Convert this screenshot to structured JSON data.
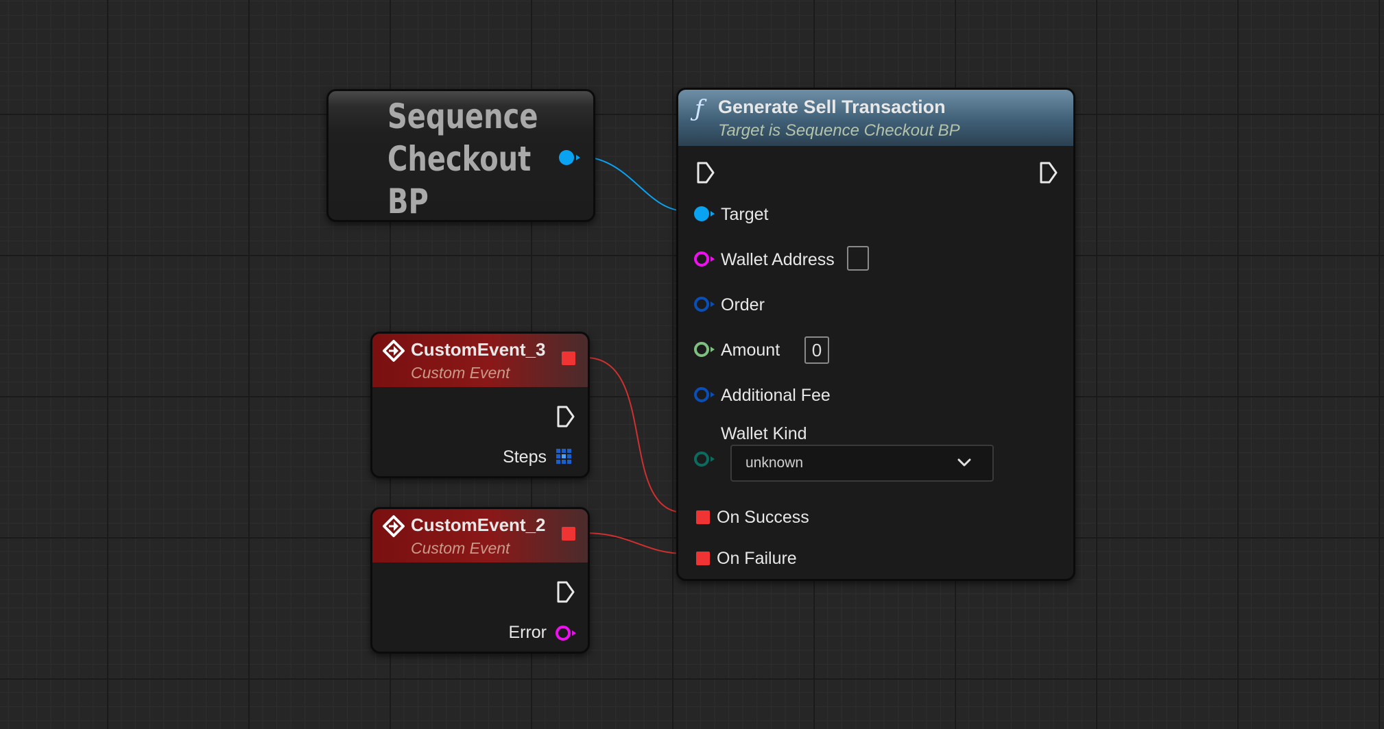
{
  "graph": {
    "variable_node": {
      "title": "Sequence\nCheckout\nBP"
    },
    "function_node": {
      "icon": "function-icon",
      "title": "Generate Sell Transaction",
      "subtitle": "Target is Sequence Checkout BP",
      "pins": {
        "target": "Target",
        "wallet_address": "Wallet Address",
        "order": "Order",
        "amount": "Amount",
        "amount_value": "0",
        "additional_fee": "Additional Fee",
        "wallet_kind": "Wallet Kind",
        "wallet_kind_value": "unknown",
        "on_success": "On Success",
        "on_failure": "On Failure"
      }
    },
    "event_3": {
      "title": "CustomEvent_3",
      "subtitle": "Custom Event",
      "output_label": "Steps"
    },
    "event_2": {
      "title": "CustomEvent_2",
      "subtitle": "Custom Event",
      "output_label": "Error"
    },
    "colors": {
      "object_pin": "#0aa3f2",
      "string_pin": "#f00ff0",
      "struct_pin": "#0a4fb8",
      "number_pin": "#7fc080",
      "enum_pin": "#0b6b5f",
      "delegate_pin": "#f03434",
      "wire_object": "#0aa3f2",
      "wire_delegate": "#d03030"
    }
  }
}
